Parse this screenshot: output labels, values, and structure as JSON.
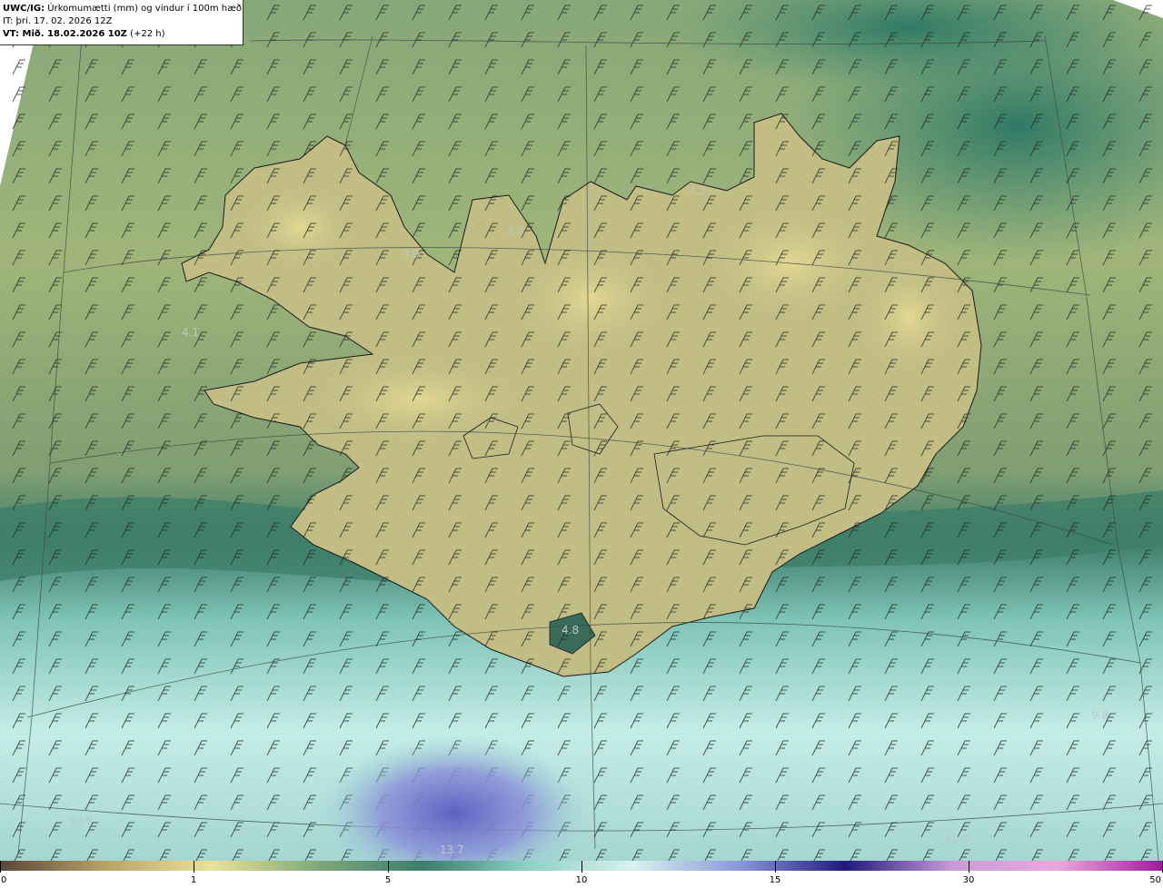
{
  "header": {
    "product": "UWC/IG:",
    "title": " Úrkomumætti (mm) og vindur í 100m hæð",
    "it_line": "IT: þri. 17. 02. 2026 12Z",
    "vt_label": "VT: Mið. 18.02.2026 10Z",
    "vt_offset": " (+22 h)"
  },
  "map_labels": [
    {
      "text": "3.9",
      "id": "label-3-9"
    },
    {
      "text": "3.8",
      "id": "label-3-8"
    },
    {
      "text": "4.3",
      "id": "label-4-3"
    },
    {
      "text": "4.1",
      "id": "label-4-1"
    },
    {
      "text": "4.8",
      "id": "label-4-8"
    },
    {
      "text": "9.8",
      "id": "label-9-8"
    },
    {
      "text": "10.1",
      "id": "label-10-1"
    },
    {
      "text": "13.7",
      "id": "label-13-7"
    },
    {
      "text": "10.5",
      "id": "label-10-5"
    }
  ],
  "colorbar": {
    "ticks": [
      "0",
      "1",
      "5",
      "10",
      "15",
      "30",
      "50"
    ],
    "colors": [
      "#5a4636",
      "#b9a36b",
      "#e9e29a",
      "#7fa87a",
      "#3d7d6c",
      "#8fd0c8",
      "#d8f2ee",
      "#8a97d8",
      "#1f1a7a",
      "#c89ad8",
      "#e9a9dd",
      "#a01a9a"
    ]
  }
}
